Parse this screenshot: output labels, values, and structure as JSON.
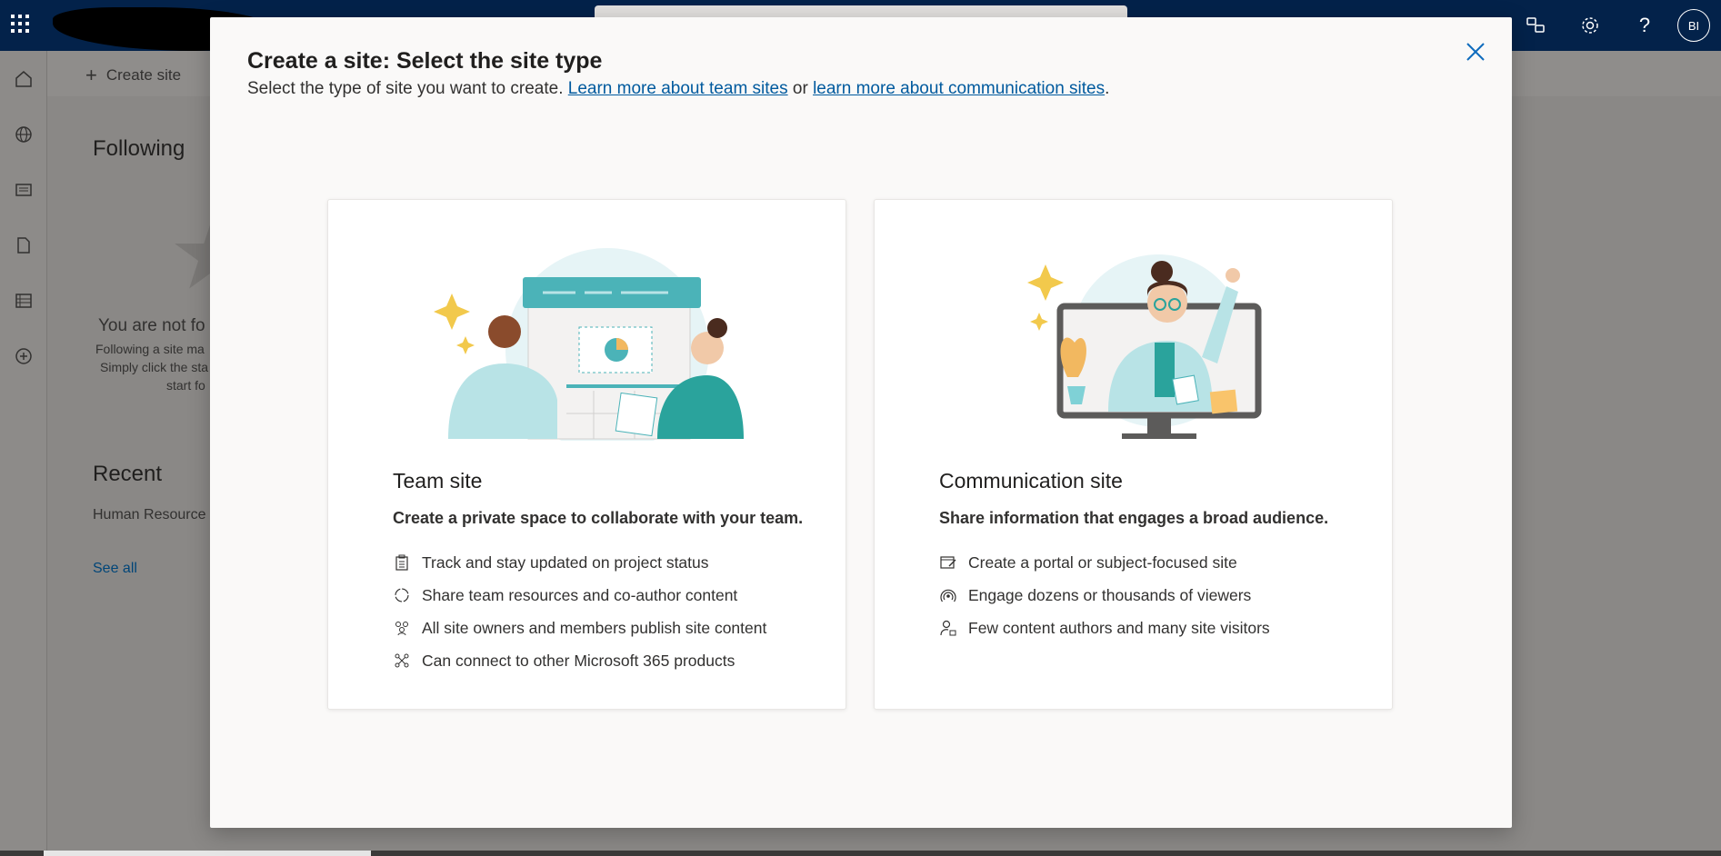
{
  "suite": {
    "avatar_initials": "BI"
  },
  "background": {
    "create_site_label": "Create site",
    "following_heading": "Following",
    "empty_title": "You are not fo",
    "empty_line1": "Following a site ma",
    "empty_line2": "Simply click the sta",
    "empty_line3": "start fo",
    "recent_heading": "Recent",
    "recent_item": "Human Resource",
    "see_all": "See all"
  },
  "modal": {
    "title": "Create a site: Select the site type",
    "subtitle_prefix": "Select the type of site you want to create. ",
    "link_team": "Learn more about team sites",
    "subtitle_or": " or ",
    "link_comm": "learn more about communication sites",
    "subtitle_end": "."
  },
  "team_card": {
    "title": "Team site",
    "description": "Create a private space to collaborate with your team.",
    "features": [
      {
        "icon": "clipboard-icon",
        "label": "Track and stay updated on project status"
      },
      {
        "icon": "sync-icon",
        "label": "Share team resources and co-author content"
      },
      {
        "icon": "people-icon",
        "label": "All site owners and members publish site content"
      },
      {
        "icon": "connect-icon",
        "label": "Can connect to other Microsoft 365 products"
      }
    ]
  },
  "comm_card": {
    "title": "Communication site",
    "description": "Share information that engages a broad audience.",
    "features": [
      {
        "icon": "page-edit-icon",
        "label": "Create a portal or subject-focused site"
      },
      {
        "icon": "broadcast-icon",
        "label": "Engage dozens or thousands of viewers"
      },
      {
        "icon": "person-key-icon",
        "label": "Few content authors and many site visitors"
      }
    ]
  },
  "colors": {
    "suitebar": "#03224a",
    "link": "#005a9e",
    "close": "#0f6cbd",
    "teal": "#4bb3b8"
  }
}
